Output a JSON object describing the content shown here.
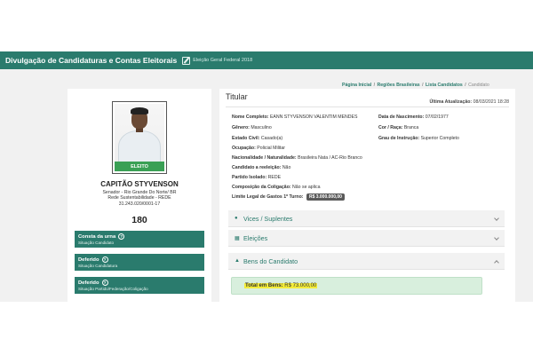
{
  "header": {
    "title": "Divulgação de Candidaturas e Contas Eleitorais",
    "subtitle": "Eleição Geral Federal 2018"
  },
  "breadcrumb": [
    "Página Inicial",
    "Regiões Brasileiras",
    "Lista Candidatos",
    "Candidato"
  ],
  "candidate": {
    "status_band": "ELEITO",
    "name": "CAPITÃO STYVENSON",
    "office_line": "Senador - Rio Grande Do Norte/ BR",
    "party_line": "Rede Sustentabilidade - REDE",
    "cnpj": "31.243.020/0001-17",
    "number": "180"
  },
  "status_boxes": [
    {
      "title": "Consta da urna",
      "sub": "Situação Candidato"
    },
    {
      "title": "Deferido",
      "sub": "Situação Candidatura"
    },
    {
      "title": "Deferido",
      "sub": "Situação Partido/Federação/Coligação"
    }
  ],
  "titular": {
    "heading": "Titular",
    "last_update_label": "Última Atualização:",
    "last_update_value": "08/03/2021 18:28",
    "fields": {
      "nome_label": "Nome Completo:",
      "nome_value": "EANN STYVENSON VALENTIM MENDES",
      "nasc_label": "Data de Nascimento:",
      "nasc_value": "07/02/1977",
      "genero_label": "Gênero:",
      "genero_value": "Masculino",
      "cor_label": "Cor / Raça:",
      "cor_value": "Branca",
      "civil_label": "Estado Civil:",
      "civil_value": "Casado(a)",
      "instrucao_label": "Grau de Instrução:",
      "instrucao_value": "Superior Completo",
      "ocupacao_label": "Ocupação:",
      "ocupacao_value": "Policial Militar",
      "nacionalidade_label": "Nacionalidade / Naturalidade:",
      "nacionalidade_value": "Brasileira Nata / AC-Rio Branco",
      "reeleicao_label": "Candidato a reeleição:",
      "reeleicao_value": "Não",
      "partido_label": "Partido Isolado:",
      "partido_value": "REDE",
      "coligacao_label": "Composição da Coligação:",
      "coligacao_value": "Não se aplica",
      "limite_label": "Limite Legal de Gastos 1º Turno:",
      "limite_value": "R$ 3.000.000,00"
    }
  },
  "accordions": {
    "vices": "Vices / Suplentes",
    "eleicoes": "Eleições",
    "bens": "Bens do Candidato"
  },
  "bens": {
    "total_label": "Total em Bens:",
    "total_value": "R$ 73.000,00"
  },
  "colors": {
    "brand": "#2a7b6d",
    "elected": "#3aa055",
    "highlight": "#f3ec3a"
  }
}
